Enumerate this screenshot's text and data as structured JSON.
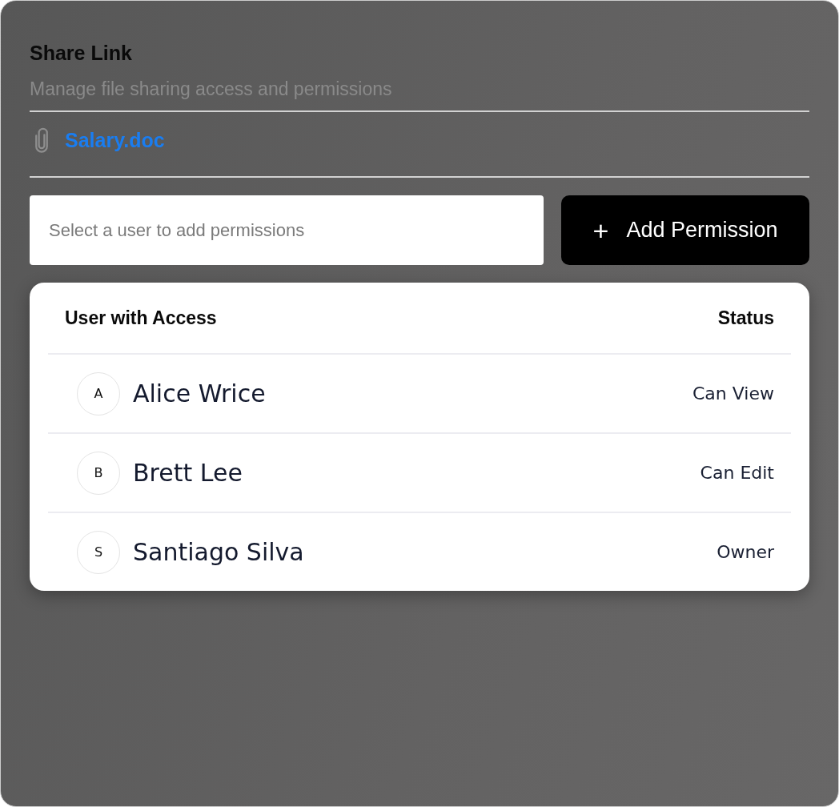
{
  "title": "Share Link",
  "subtitle": "Manage file sharing access and permissions",
  "file": {
    "name": "Salary.doc"
  },
  "user_select": {
    "placeholder": "Select a user to add permissions"
  },
  "add_button": {
    "icon": "+",
    "label": "Add Permission"
  },
  "access_table": {
    "columns": [
      "User with Access",
      "Status"
    ],
    "rows": [
      {
        "initial": "A",
        "name": "Alice Wrice",
        "status": "Can View"
      },
      {
        "initial": "B",
        "name": "Brett Lee",
        "status": "Can Edit"
      },
      {
        "initial": "S",
        "name": "Santiago Silva",
        "status": "Owner"
      }
    ]
  }
}
